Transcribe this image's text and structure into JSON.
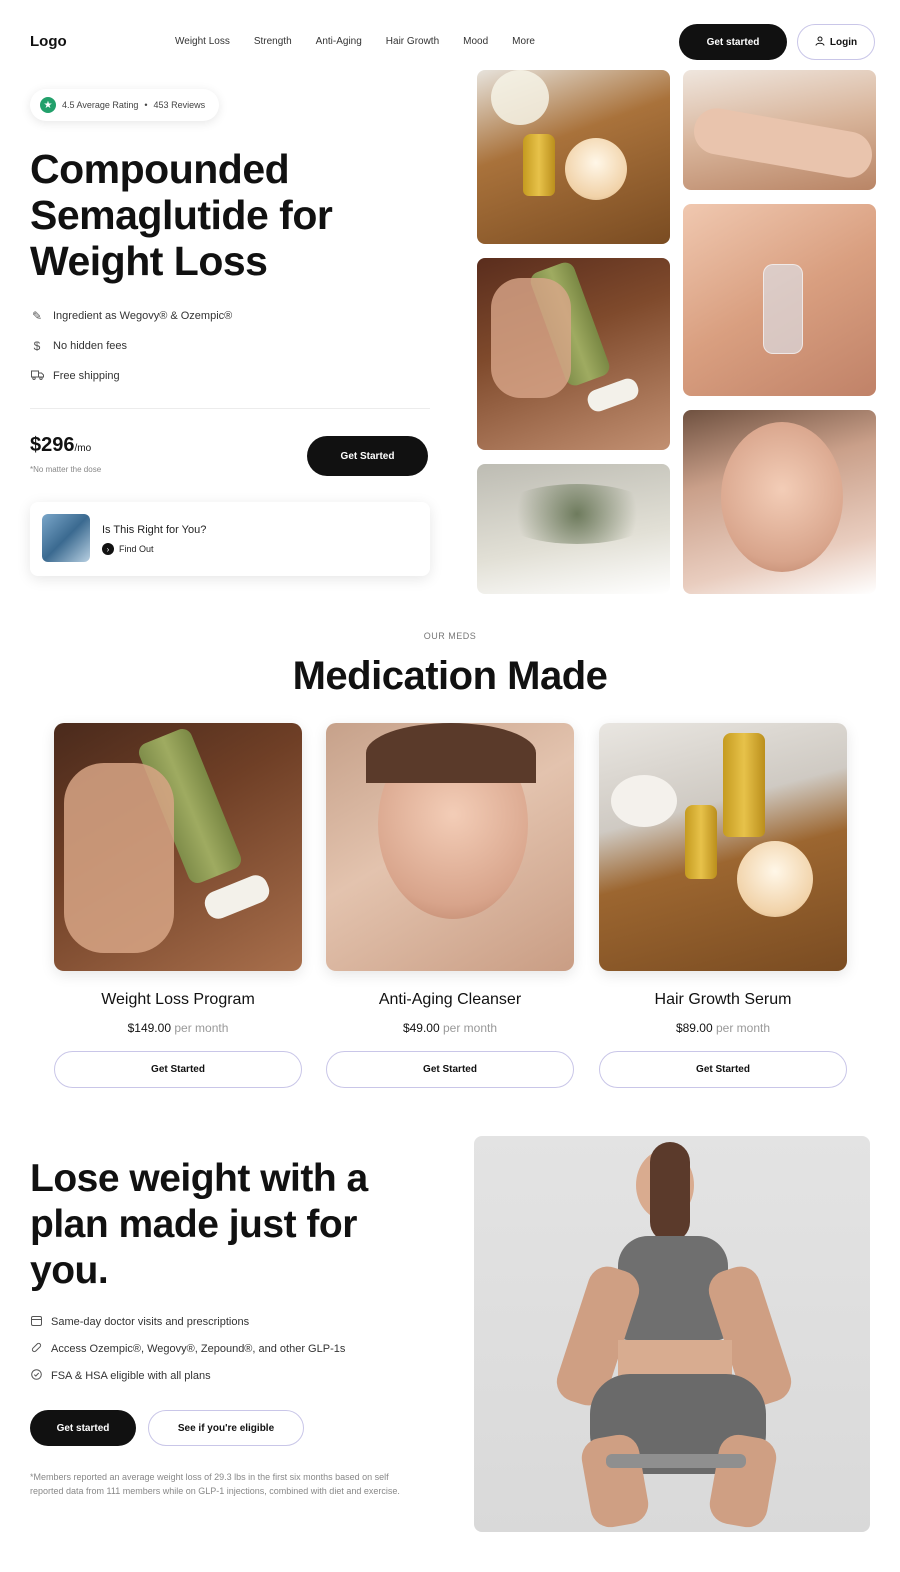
{
  "nav": {
    "logo": "Logo",
    "links": [
      "Weight Loss",
      "Strength",
      "Anti-Aging",
      "Hair Growth",
      "Mood",
      "More"
    ],
    "cta": "Get started",
    "login": "Login"
  },
  "hero": {
    "rating": "4.5 Average Rating",
    "separator": "•",
    "reviews": "453 Reviews",
    "title": "Compounded Semaglutide for Weight Loss",
    "features": [
      {
        "icon": "pen-icon",
        "text": "Ingredient as Wegovy® & Ozempic®"
      },
      {
        "icon": "dollar-icon",
        "text": "No hidden fees"
      },
      {
        "icon": "truck-icon",
        "text": "Free shipping"
      }
    ],
    "price": "$296",
    "price_unit": "/mo",
    "price_note": "*No matter the dose",
    "cta": "Get Started",
    "quiz_title": "Is This Right for You?",
    "quiz_link": "Find Out"
  },
  "meds": {
    "eyebrow": "OUR MEDS",
    "title": "Medication Made",
    "cards": [
      {
        "name": "Weight Loss Program",
        "price": "$149.00",
        "unit": "per month",
        "cta": "Get Started"
      },
      {
        "name": "Anti-Aging Cleanser",
        "price": "$49.00",
        "unit": "per month",
        "cta": "Get Started"
      },
      {
        "name": "Hair Growth Serum",
        "price": "$89.00",
        "unit": "per month",
        "cta": "Get Started"
      }
    ]
  },
  "plan": {
    "title": "Lose weight with a plan made just for you.",
    "items": [
      {
        "icon": "calendar-icon",
        "text": "Same-day doctor visits and prescriptions"
      },
      {
        "icon": "pill-icon",
        "text": "Access Ozempic®, Wegovy®, Zepound®, and other GLP-1s"
      },
      {
        "icon": "check-circle-icon",
        "text": "FSA & HSA eligible with all plans"
      }
    ],
    "cta_primary": "Get started",
    "cta_secondary": "See if you're eligible",
    "disclaimer": "*Members reported an average weight loss of 29.3 lbs in the first six months based on self reported data from 111 members while on GLP-1 injections, combined with diet and exercise."
  },
  "colors": {
    "primary": "#111111",
    "accent_outline": "#c9c6e8",
    "rating_green": "#22a06b"
  }
}
